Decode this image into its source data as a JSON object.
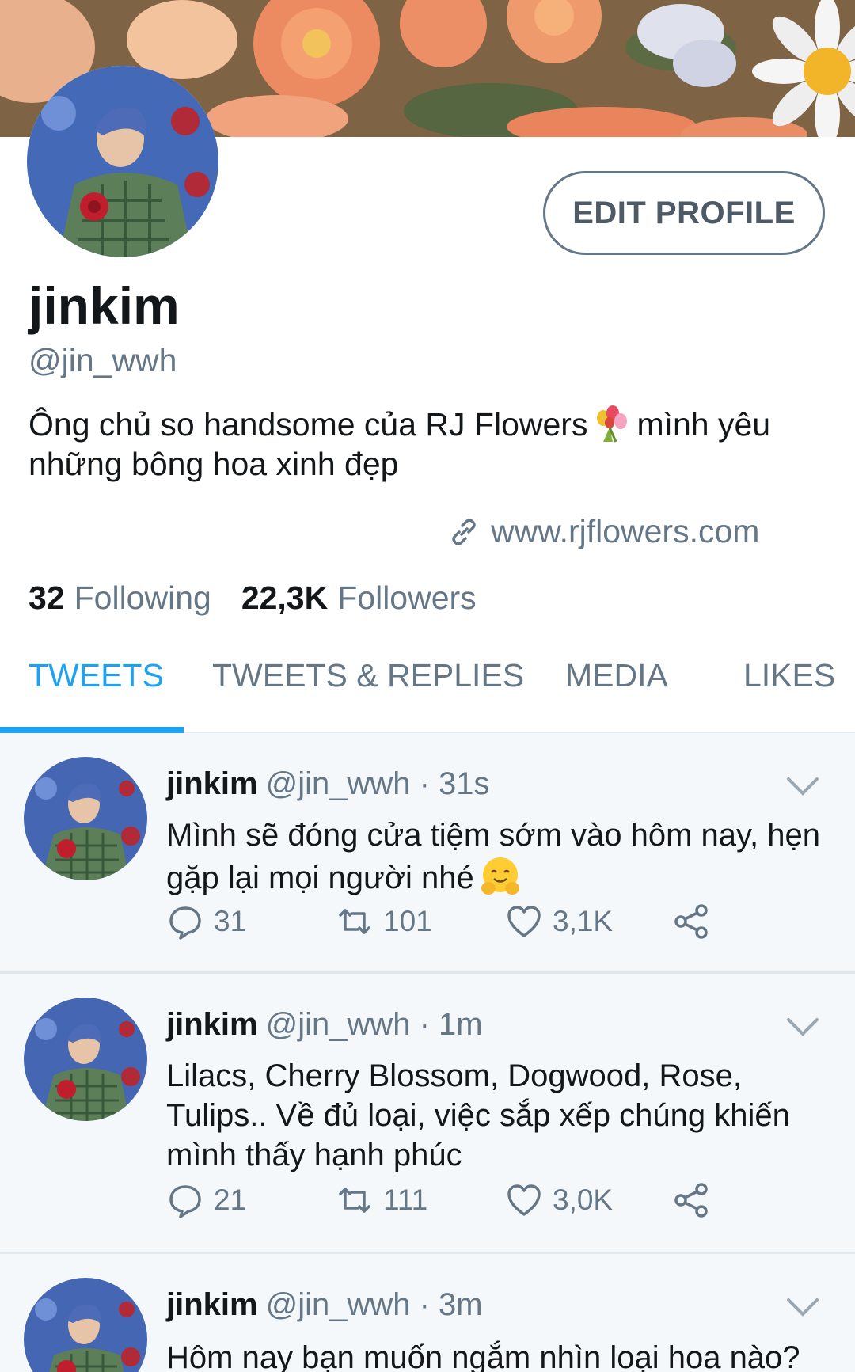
{
  "profile": {
    "display_name": "jinkim",
    "handle": "@jin_wwh",
    "bio_part1": "Ông chủ so handsome của RJ Flowers",
    "bio_part2": "mình yêu những bông hoa xinh đẹp",
    "website": "www.rjflowers.com",
    "edit_profile_label": "EDIT PROFILE",
    "following_count": "32",
    "following_label": "Following",
    "followers_count": "22,3K",
    "followers_label": "Followers"
  },
  "tabs": [
    {
      "label": "TWEETS",
      "active": true
    },
    {
      "label": "TWEETS & REPLIES",
      "active": false
    },
    {
      "label": "MEDIA",
      "active": false
    },
    {
      "label": "LIKES",
      "active": false
    }
  ],
  "tweets": [
    {
      "name": "jinkim",
      "handle": "@jin_wwh",
      "time": "· 31s",
      "text": "Mình sẽ đóng cửa tiệm sớm vào hôm nay, hẹn gặp lại mọi người nhé",
      "emoji": "hugging-face-emoji",
      "replies": "31",
      "retweets": "101",
      "likes": "3,1K"
    },
    {
      "name": "jinkim",
      "handle": "@jin_wwh",
      "time": "· 1m",
      "text": "Lilacs, Cherry Blossom, Dogwood, Rose, Tulips.. Về đủ loại, việc sắp xếp chúng khiến mình thấy hạnh phúc",
      "replies": "21",
      "retweets": "111",
      "likes": "3,0K"
    },
    {
      "name": "jinkim",
      "handle": "@jin_wwh",
      "time": "· 3m",
      "text": "Hôm nay bạn muốn ngắm nhìn loại hoa nào?"
    }
  ],
  "colors": {
    "accent": "#1da1f2",
    "secondary_text": "#657786",
    "feed_background": "#f5f8fa"
  },
  "icons": [
    "link-icon",
    "reply-icon",
    "retweet-icon",
    "like-icon",
    "share-icon",
    "chevron-down-icon",
    "bouquet-emoji"
  ]
}
